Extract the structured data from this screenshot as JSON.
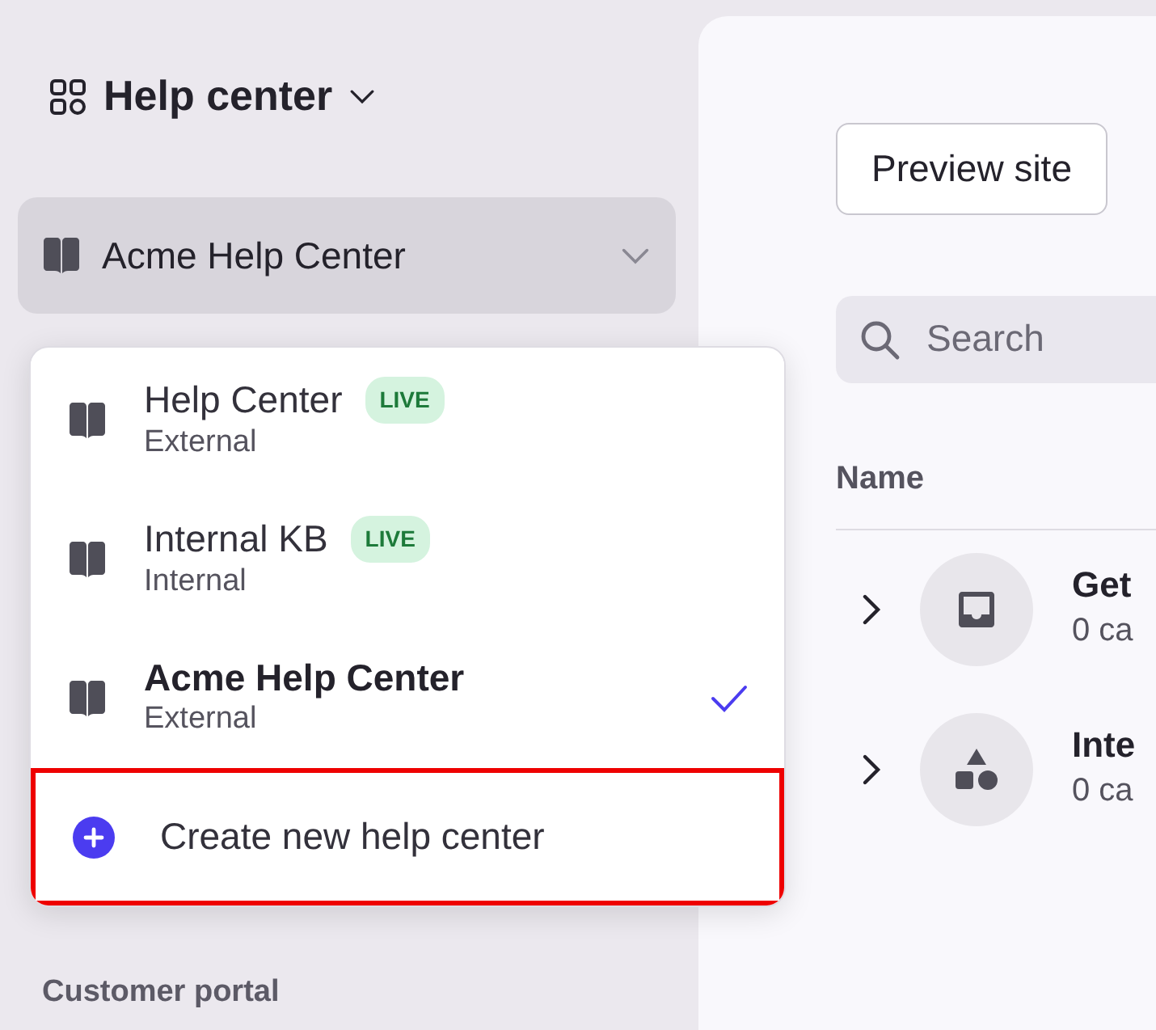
{
  "header": {
    "title": "Help center"
  },
  "selector": {
    "value": "Acme Help Center"
  },
  "dropdown": {
    "items": [
      {
        "name": "Help Center",
        "badge": "LIVE",
        "subtitle": "External",
        "selected": false
      },
      {
        "name": "Internal KB",
        "badge": "LIVE",
        "subtitle": "Internal",
        "selected": false
      },
      {
        "name": "Acme Help Center",
        "subtitle": "External",
        "selected": true
      }
    ],
    "create": {
      "label": "Create new help center",
      "highlighted": true
    }
  },
  "sidebar_section": {
    "title": "Customer portal"
  },
  "main": {
    "preview_button": "Preview site",
    "search": {
      "placeholder": "Search"
    },
    "table": {
      "columns": [
        "Name"
      ],
      "rows": [
        {
          "kind": "inbox",
          "title": "Get",
          "subtitle": "0 ca"
        },
        {
          "kind": "shapes",
          "title": "Inte",
          "subtitle": "0 ca"
        }
      ]
    }
  }
}
